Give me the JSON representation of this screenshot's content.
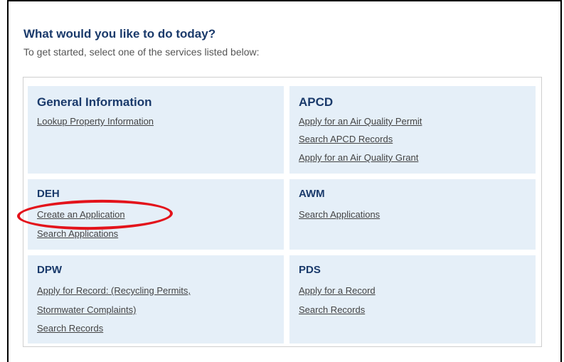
{
  "header": {
    "title": "What would you like to do today?",
    "subtitle": "To get started, select one of the services listed below:"
  },
  "panels": {
    "general": {
      "title": "General Information",
      "links": [
        "Lookup Property Information"
      ]
    },
    "apcd": {
      "title": "APCD",
      "links": [
        "Apply for an Air Quality Permit",
        "Search APCD Records",
        "Apply for an Air Quality Grant"
      ]
    },
    "deh": {
      "title": "DEH",
      "links": [
        "Create an Application",
        "Search Applications"
      ]
    },
    "awm": {
      "title": "AWM",
      "links": [
        "Search Applications"
      ]
    },
    "dpw": {
      "title": "DPW",
      "links": [
        "Apply for Record: (Recycling Permits,",
        "Stormwater Complaints)",
        "Search Records"
      ]
    },
    "pds": {
      "title": "PDS",
      "links": [
        "Apply for a Record",
        "Search Records"
      ]
    }
  },
  "colors": {
    "heading": "#1a3a6b",
    "panel_background": "#e5eff8",
    "highlight_ring": "#e3131b"
  }
}
